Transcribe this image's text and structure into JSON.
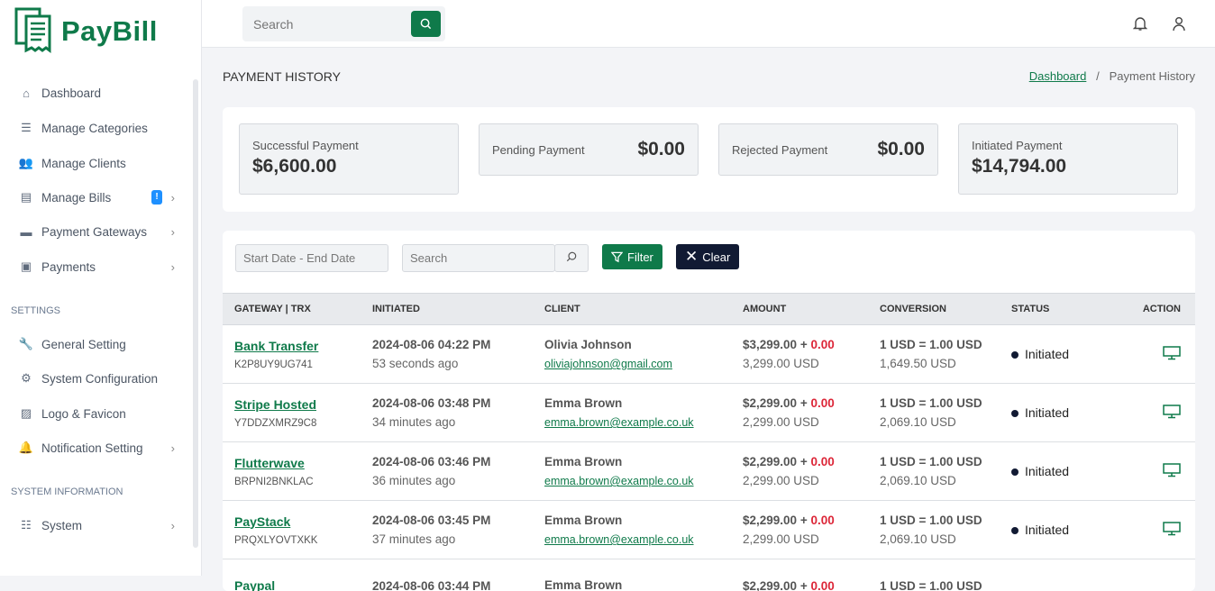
{
  "app": {
    "name": "PayBill"
  },
  "sidebar": {
    "items": [
      {
        "label": "Dashboard",
        "icon": "home-icon"
      },
      {
        "label": "Manage Categories",
        "icon": "list-icon"
      },
      {
        "label": "Manage Clients",
        "icon": "users-icon"
      },
      {
        "label": "Manage Bills",
        "icon": "bill-icon",
        "badge": "!"
      },
      {
        "label": "Payment Gateways",
        "icon": "card-icon"
      },
      {
        "label": "Payments",
        "icon": "money-icon"
      }
    ],
    "settings_label": "SETTINGS",
    "settings": [
      {
        "label": "General Setting"
      },
      {
        "label": "System Configuration"
      },
      {
        "label": "Logo & Favicon"
      },
      {
        "label": "Notification Setting"
      }
    ],
    "sysinfo_label": "SYSTEM INFORMATION",
    "sysinfo": [
      {
        "label": "System"
      }
    ]
  },
  "header": {
    "search_placeholder": "Search"
  },
  "page": {
    "title": "PAYMENT HISTORY",
    "breadcrumb": [
      "Dashboard",
      "Payment History"
    ]
  },
  "stats": [
    {
      "label": "Successful Payment",
      "value": "$6,600.00"
    },
    {
      "label": "Pending Payment",
      "value": "$0.00"
    },
    {
      "label": "Rejected Payment",
      "value": "$0.00"
    },
    {
      "label": "Initiated Payment",
      "value": "$14,794.00"
    }
  ],
  "filters": {
    "date_placeholder": "Start Date - End Date",
    "search_placeholder": "Search",
    "filter_label": "Filter",
    "clear_label": "Clear"
  },
  "table": {
    "columns": [
      "GATEWAY | TRX",
      "INITIATED",
      "CLIENT",
      "AMOUNT",
      "CONVERSION",
      "STATUS",
      "ACTION"
    ],
    "rows": [
      {
        "gateway": "Bank Transfer",
        "trx": "K2P8UY9UG741",
        "date": "2024-08-06 04:22 PM",
        "ago": "53 seconds ago",
        "client": "Olivia Johnson",
        "email": "oliviajohnson@gmail.com",
        "amount": "$3,299.00",
        "plus": "+",
        "charge": "0.00",
        "total": "3,299.00 USD",
        "rate": "1 USD = 1.00 USD",
        "converted": "1,649.50 USD",
        "status": "Initiated"
      },
      {
        "gateway": "Stripe Hosted",
        "trx": "Y7DDZXMRZ9C8",
        "date": "2024-08-06 03:48 PM",
        "ago": "34 minutes ago",
        "client": "Emma Brown",
        "email": "emma.brown@example.co.uk",
        "amount": "$2,299.00",
        "plus": "+",
        "charge": "0.00",
        "total": "2,299.00 USD",
        "rate": "1 USD = 1.00 USD",
        "converted": "2,069.10 USD",
        "status": "Initiated"
      },
      {
        "gateway": "Flutterwave",
        "trx": "BRPNI2BNKLAC",
        "date": "2024-08-06 03:46 PM",
        "ago": "36 minutes ago",
        "client": "Emma Brown",
        "email": "emma.brown@example.co.uk",
        "amount": "$2,299.00",
        "plus": "+",
        "charge": "0.00",
        "total": "2,299.00 USD",
        "rate": "1 USD = 1.00 USD",
        "converted": "2,069.10 USD",
        "status": "Initiated"
      },
      {
        "gateway": "PayStack",
        "trx": "PRQXLYOVTXKK",
        "date": "2024-08-06 03:45 PM",
        "ago": "37 minutes ago",
        "client": "Emma Brown",
        "email": "emma.brown@example.co.uk",
        "amount": "$2,299.00",
        "plus": "+",
        "charge": "0.00",
        "total": "2,299.00 USD",
        "rate": "1 USD = 1.00 USD",
        "converted": "2,069.10 USD",
        "status": "Initiated"
      },
      {
        "gateway": "Paypal",
        "trx": "",
        "date": "2024-08-06 03:44 PM",
        "ago": "",
        "client": "Emma Brown",
        "email": "",
        "amount": "$2,299.00",
        "plus": "+",
        "charge": "0.00",
        "total": "",
        "rate": "1 USD = 1.00 USD",
        "converted": "",
        "status": ""
      }
    ]
  },
  "colors": {
    "brand": "#0f7a4a",
    "danger": "#dc2638",
    "dark": "#111a33"
  }
}
